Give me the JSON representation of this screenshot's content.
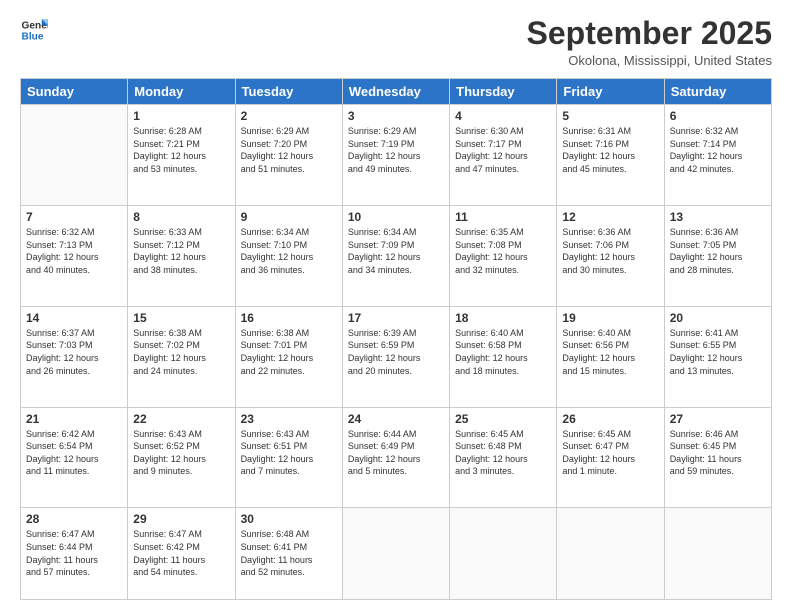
{
  "logo": {
    "line1": "General",
    "line2": "Blue"
  },
  "title": "September 2025",
  "location": "Okolona, Mississippi, United States",
  "days_of_week": [
    "Sunday",
    "Monday",
    "Tuesday",
    "Wednesday",
    "Thursday",
    "Friday",
    "Saturday"
  ],
  "weeks": [
    [
      {
        "day": "",
        "info": ""
      },
      {
        "day": "1",
        "info": "Sunrise: 6:28 AM\nSunset: 7:21 PM\nDaylight: 12 hours\nand 53 minutes."
      },
      {
        "day": "2",
        "info": "Sunrise: 6:29 AM\nSunset: 7:20 PM\nDaylight: 12 hours\nand 51 minutes."
      },
      {
        "day": "3",
        "info": "Sunrise: 6:29 AM\nSunset: 7:19 PM\nDaylight: 12 hours\nand 49 minutes."
      },
      {
        "day": "4",
        "info": "Sunrise: 6:30 AM\nSunset: 7:17 PM\nDaylight: 12 hours\nand 47 minutes."
      },
      {
        "day": "5",
        "info": "Sunrise: 6:31 AM\nSunset: 7:16 PM\nDaylight: 12 hours\nand 45 minutes."
      },
      {
        "day": "6",
        "info": "Sunrise: 6:32 AM\nSunset: 7:14 PM\nDaylight: 12 hours\nand 42 minutes."
      }
    ],
    [
      {
        "day": "7",
        "info": "Sunrise: 6:32 AM\nSunset: 7:13 PM\nDaylight: 12 hours\nand 40 minutes."
      },
      {
        "day": "8",
        "info": "Sunrise: 6:33 AM\nSunset: 7:12 PM\nDaylight: 12 hours\nand 38 minutes."
      },
      {
        "day": "9",
        "info": "Sunrise: 6:34 AM\nSunset: 7:10 PM\nDaylight: 12 hours\nand 36 minutes."
      },
      {
        "day": "10",
        "info": "Sunrise: 6:34 AM\nSunset: 7:09 PM\nDaylight: 12 hours\nand 34 minutes."
      },
      {
        "day": "11",
        "info": "Sunrise: 6:35 AM\nSunset: 7:08 PM\nDaylight: 12 hours\nand 32 minutes."
      },
      {
        "day": "12",
        "info": "Sunrise: 6:36 AM\nSunset: 7:06 PM\nDaylight: 12 hours\nand 30 minutes."
      },
      {
        "day": "13",
        "info": "Sunrise: 6:36 AM\nSunset: 7:05 PM\nDaylight: 12 hours\nand 28 minutes."
      }
    ],
    [
      {
        "day": "14",
        "info": "Sunrise: 6:37 AM\nSunset: 7:03 PM\nDaylight: 12 hours\nand 26 minutes."
      },
      {
        "day": "15",
        "info": "Sunrise: 6:38 AM\nSunset: 7:02 PM\nDaylight: 12 hours\nand 24 minutes."
      },
      {
        "day": "16",
        "info": "Sunrise: 6:38 AM\nSunset: 7:01 PM\nDaylight: 12 hours\nand 22 minutes."
      },
      {
        "day": "17",
        "info": "Sunrise: 6:39 AM\nSunset: 6:59 PM\nDaylight: 12 hours\nand 20 minutes."
      },
      {
        "day": "18",
        "info": "Sunrise: 6:40 AM\nSunset: 6:58 PM\nDaylight: 12 hours\nand 18 minutes."
      },
      {
        "day": "19",
        "info": "Sunrise: 6:40 AM\nSunset: 6:56 PM\nDaylight: 12 hours\nand 15 minutes."
      },
      {
        "day": "20",
        "info": "Sunrise: 6:41 AM\nSunset: 6:55 PM\nDaylight: 12 hours\nand 13 minutes."
      }
    ],
    [
      {
        "day": "21",
        "info": "Sunrise: 6:42 AM\nSunset: 6:54 PM\nDaylight: 12 hours\nand 11 minutes."
      },
      {
        "day": "22",
        "info": "Sunrise: 6:43 AM\nSunset: 6:52 PM\nDaylight: 12 hours\nand 9 minutes."
      },
      {
        "day": "23",
        "info": "Sunrise: 6:43 AM\nSunset: 6:51 PM\nDaylight: 12 hours\nand 7 minutes."
      },
      {
        "day": "24",
        "info": "Sunrise: 6:44 AM\nSunset: 6:49 PM\nDaylight: 12 hours\nand 5 minutes."
      },
      {
        "day": "25",
        "info": "Sunrise: 6:45 AM\nSunset: 6:48 PM\nDaylight: 12 hours\nand 3 minutes."
      },
      {
        "day": "26",
        "info": "Sunrise: 6:45 AM\nSunset: 6:47 PM\nDaylight: 12 hours\nand 1 minute."
      },
      {
        "day": "27",
        "info": "Sunrise: 6:46 AM\nSunset: 6:45 PM\nDaylight: 11 hours\nand 59 minutes."
      }
    ],
    [
      {
        "day": "28",
        "info": "Sunrise: 6:47 AM\nSunset: 6:44 PM\nDaylight: 11 hours\nand 57 minutes."
      },
      {
        "day": "29",
        "info": "Sunrise: 6:47 AM\nSunset: 6:42 PM\nDaylight: 11 hours\nand 54 minutes."
      },
      {
        "day": "30",
        "info": "Sunrise: 6:48 AM\nSunset: 6:41 PM\nDaylight: 11 hours\nand 52 minutes."
      },
      {
        "day": "",
        "info": ""
      },
      {
        "day": "",
        "info": ""
      },
      {
        "day": "",
        "info": ""
      },
      {
        "day": "",
        "info": ""
      }
    ]
  ]
}
